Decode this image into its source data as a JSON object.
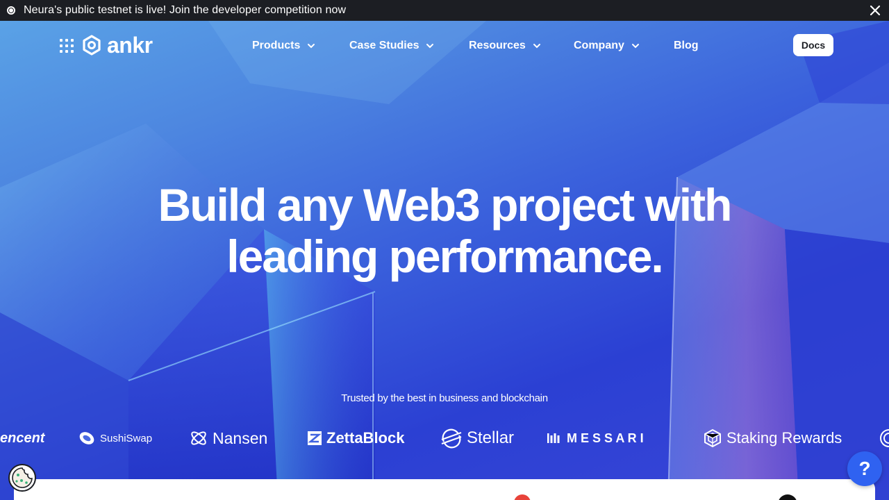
{
  "announcement": {
    "message": "Neura's public testnet is live! Join the developer competition now"
  },
  "brand": {
    "name": "ankr"
  },
  "nav": {
    "items": [
      {
        "label": "Products",
        "has_dropdown": true
      },
      {
        "label": "Case Studies",
        "has_dropdown": true
      },
      {
        "label": "Resources",
        "has_dropdown": true
      },
      {
        "label": "Company",
        "has_dropdown": true
      },
      {
        "label": "Blog",
        "has_dropdown": false
      }
    ],
    "docs_label": "Docs"
  },
  "hero": {
    "headline_line1": "Build any Web3 project with",
    "headline_line2": "leading performance.",
    "trusted_text": "Trusted by the best in business and blockchain"
  },
  "partners": [
    {
      "name": "Tencent",
      "display": "encent"
    },
    {
      "name": "SushiSwap",
      "display": "SushiSwap"
    },
    {
      "name": "Nansen",
      "display": "Nansen"
    },
    {
      "name": "ZettaBlock",
      "display": "ZettaBlock"
    },
    {
      "name": "Stellar",
      "display": "Stellar"
    },
    {
      "name": "Messari",
      "display": "M E S S A R I"
    },
    {
      "name": "Staking Rewards",
      "display": "Staking Rewards"
    }
  ],
  "help": {
    "label": "?"
  },
  "colors": {
    "announcement_bg": "#1c1e23",
    "hero_blue": "#2d4bd8",
    "help_button": "#2f62f1",
    "text_on_hero": "#ffffff"
  },
  "icons": {
    "announcement": "radio-dot-icon",
    "close": "close-icon",
    "app_grid": "grid-icon",
    "dropdown": "chevron-down-icon",
    "cookie": "cookie-icon",
    "help": "question-icon"
  }
}
